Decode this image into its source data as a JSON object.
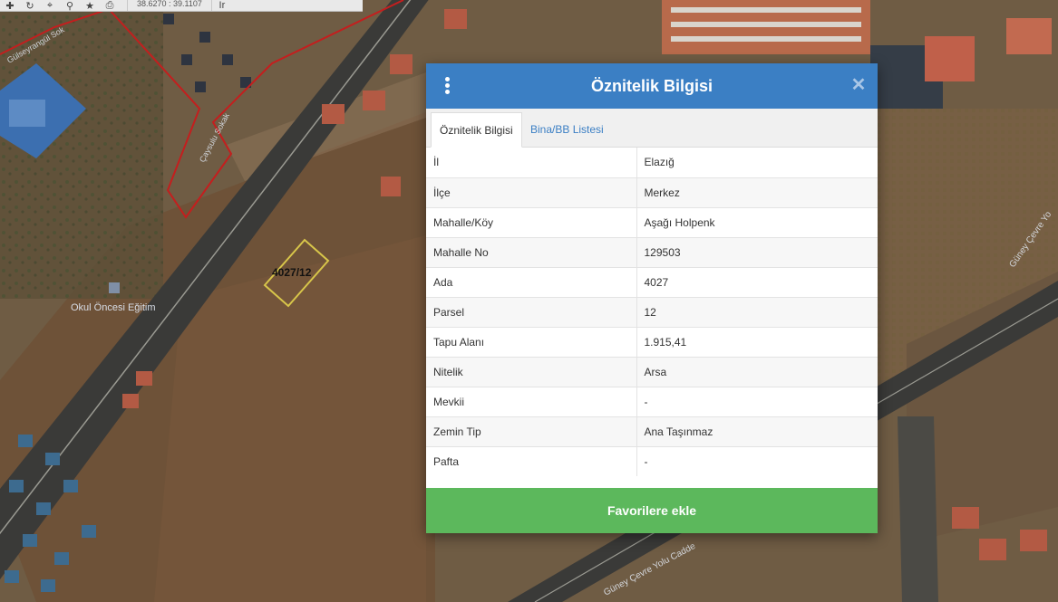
{
  "toolbar": {
    "coordinate_text": "38.6270 : 39.1107",
    "icons": [
      "plus-icon",
      "refresh-icon",
      "locate-icon",
      "pin-icon",
      "star-icon",
      "print-icon"
    ],
    "extra": "Ir"
  },
  "map": {
    "labels": {
      "parcel": "4027/12",
      "poi": "Okul Öncesi Eğitim",
      "road_1": "Güney Çevre Yolu Cadde",
      "road_2": "Güney Çevre Yo",
      "street": "Çaysulu Sokak",
      "top_street": "Gülseyrangül Sok"
    }
  },
  "dialog": {
    "title": "Öznitelik Bilgisi",
    "tabs": [
      {
        "label": "Öznitelik Bilgisi",
        "active": true
      },
      {
        "label": "Bina/BB Listesi",
        "active": false
      }
    ],
    "rows": [
      {
        "key": "İl",
        "value": "Elazığ"
      },
      {
        "key": "İlçe",
        "value": "Merkez"
      },
      {
        "key": "Mahalle/Köy",
        "value": "Aşağı Holpenk"
      },
      {
        "key": "Mahalle No",
        "value": "129503"
      },
      {
        "key": "Ada",
        "value": "4027"
      },
      {
        "key": "Parsel",
        "value": "12"
      },
      {
        "key": "Tapu Alanı",
        "value": "1.915,41"
      },
      {
        "key": "Nitelik",
        "value": "Arsa"
      },
      {
        "key": "Mevkii",
        "value": "-"
      },
      {
        "key": "Zemin Tip",
        "value": "Ana Taşınmaz"
      },
      {
        "key": "Pafta",
        "value": "-"
      }
    ],
    "favorite_button": "Favorilere ekle"
  },
  "colors": {
    "header": "#3b7fc4",
    "button": "#5cb85c",
    "parcel_outline": "#d8c64a",
    "boundary": "#c41e1e"
  }
}
